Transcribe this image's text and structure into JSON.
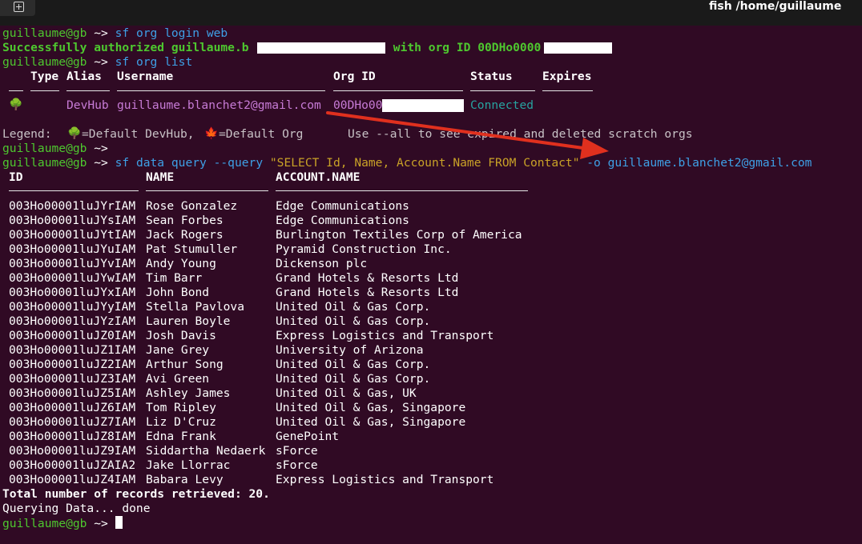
{
  "window": {
    "title": "fish /home/guillaume"
  },
  "prompt": {
    "user_host": "guillaume@gb",
    "arrow": " ~> "
  },
  "cmd1": {
    "text": "sf org login web"
  },
  "auth": {
    "prefix": "Successfully authorized guillaume.b",
    "mid": " with org ID 00DHo0000"
  },
  "cmd2": {
    "text": "sf org list"
  },
  "org_table": {
    "headers": [
      "Type",
      "Alias",
      "Username",
      "Org ID",
      "Status",
      "Expires"
    ],
    "row": {
      "icon": "tree-icon",
      "alias": "DevHub",
      "username": "guillaume.blanchet2@gmail.com",
      "org_id": "00DHo00",
      "status": "Connected"
    }
  },
  "legend": {
    "label": "Legend:",
    "devhub": "=Default DevHub,",
    "org": "=Default Org",
    "hint": "Use --all to see expired and deleted scratch orgs"
  },
  "cmd3": {
    "base": "sf data query --query ",
    "query": "\"SELECT Id, Name, Account.Name FROM Contact\"",
    "flag": " -o ",
    "target": "guillaume.blanchet2@gmail.com"
  },
  "results": {
    "headers": [
      "ID",
      "NAME",
      "ACCOUNT.NAME"
    ],
    "rows": [
      [
        "003Ho00001luJYrIAM",
        "Rose Gonzalez",
        "Edge Communications"
      ],
      [
        "003Ho00001luJYsIAM",
        "Sean Forbes",
        "Edge Communications"
      ],
      [
        "003Ho00001luJYtIAM",
        "Jack Rogers",
        "Burlington Textiles Corp of America"
      ],
      [
        "003Ho00001luJYuIAM",
        "Pat Stumuller",
        "Pyramid Construction Inc."
      ],
      [
        "003Ho00001luJYvIAM",
        "Andy Young",
        "Dickenson plc"
      ],
      [
        "003Ho00001luJYwIAM",
        "Tim Barr",
        "Grand Hotels & Resorts Ltd"
      ],
      [
        "003Ho00001luJYxIAM",
        "John Bond",
        "Grand Hotels & Resorts Ltd"
      ],
      [
        "003Ho00001luJYyIAM",
        "Stella Pavlova",
        "United Oil & Gas Corp."
      ],
      [
        "003Ho00001luJYzIAM",
        "Lauren Boyle",
        "United Oil & Gas Corp."
      ],
      [
        "003Ho00001luJZ0IAM",
        "Josh Davis",
        "Express Logistics and Transport"
      ],
      [
        "003Ho00001luJZ1IAM",
        "Jane Grey",
        "University of Arizona"
      ],
      [
        "003Ho00001luJZ2IAM",
        "Arthur Song",
        "United Oil & Gas Corp."
      ],
      [
        "003Ho00001luJZ3IAM",
        "Avi Green",
        "United Oil & Gas Corp."
      ],
      [
        "003Ho00001luJZ5IAM",
        "Ashley James",
        "United Oil & Gas, UK"
      ],
      [
        "003Ho00001luJZ6IAM",
        "Tom Ripley",
        "United Oil & Gas, Singapore"
      ],
      [
        "003Ho00001luJZ7IAM",
        "Liz D'Cruz",
        "United Oil & Gas, Singapore"
      ],
      [
        "003Ho00001luJZ8IAM",
        "Edna Frank",
        "GenePoint"
      ],
      [
        "003Ho00001luJZ9IAM",
        "Siddartha Nedaerk",
        "sForce"
      ],
      [
        "003Ho00001luJZAIA2",
        "Jake Llorrac",
        "sForce"
      ],
      [
        "003Ho00001luJZ4IAM",
        "Babara Levy",
        "Express Logistics and Transport"
      ]
    ]
  },
  "summary": {
    "total": "Total number of records retrieved: 20.",
    "status": "Querying Data... done"
  },
  "colors": {
    "background": "#300a24",
    "prompt": "#4ec82f",
    "command": "#3ea0e6",
    "query_string": "#c9a227",
    "arrow": "#e0301e"
  }
}
